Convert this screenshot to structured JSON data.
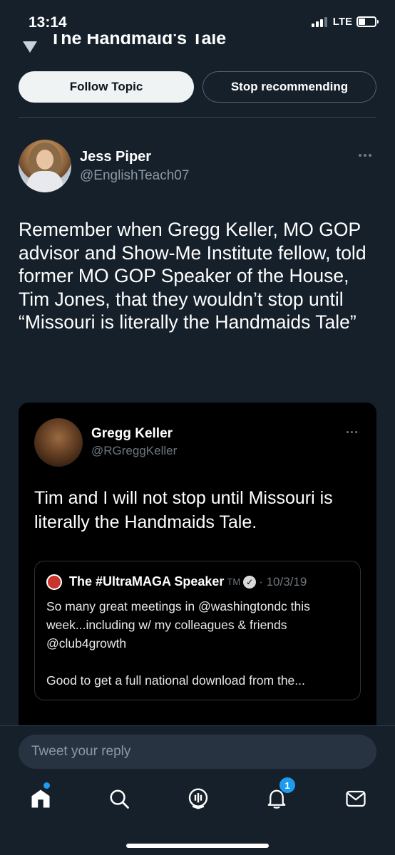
{
  "status_bar": {
    "time": "13:14",
    "network": "LTE"
  },
  "topic": {
    "title": "The Handmaid's Tale",
    "follow_label": "Follow Topic",
    "stop_label": "Stop recommending"
  },
  "tweet": {
    "author_name": "Jess Piper",
    "author_handle": "@EnglishTeach07",
    "text": "Remember when Gregg Keller, MO GOP advisor and Show-Me Institute fellow, told former MO GOP Speaker of the House, Tim Jones, that they wouldn’t stop until “Missouri is literally the Handmaids Tale”",
    "image": {
      "author_name": "Gregg Keller",
      "author_handle": "@RGreggKeller",
      "text": "Tim and I will not stop until Missouri is literally the Handmaids Tale.",
      "quote": {
        "name": "The #UltraMAGA Speaker",
        "tm": "TM",
        "date": "· 10/3/19",
        "text": "So many great meetings in @washingtondc this week...including w/ my colleagues & friends @club4growth",
        "text2": "Good to get a full national download from the..."
      }
    }
  },
  "reply": {
    "placeholder": "Tweet your reply"
  },
  "tab_bar": {
    "notification_count": "1"
  },
  "colors": {
    "background": "#15202b",
    "accent": "#1d9bf0",
    "secondary_text": "#8b98a5"
  }
}
